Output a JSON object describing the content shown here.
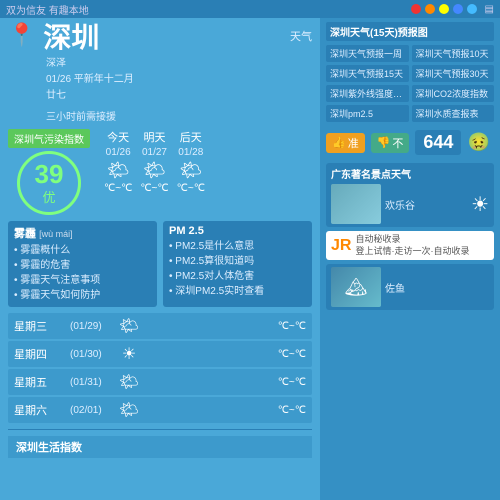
{
  "topbar": {
    "left_text": "双为信友 有趣本地",
    "icons": [
      "red",
      "orange",
      "yellow",
      "blue",
      "teal",
      "gray"
    ]
  },
  "header": {
    "city": "深圳",
    "pin_icon": "📍",
    "weather_label": "天气",
    "date_line1": "深泽",
    "date_line2": "01/26 平新年十二月",
    "date_line3": "廿七",
    "source": "三小时前需接援"
  },
  "aqi": {
    "green_bar": "深圳气污染指数",
    "number": "39",
    "quality": "优"
  },
  "forecast": {
    "today": {
      "label": "今天",
      "date": "01/26",
      "icon": "🌤",
      "temp": "℃~℃"
    },
    "tomorrow": {
      "label": "明天",
      "date": "01/27",
      "icon": "🌤",
      "temp": "℃~℃"
    },
    "aftertomorrow": {
      "label": "后天",
      "date": "01/28",
      "icon": "🌤",
      "temp": "℃~℃"
    }
  },
  "extended": [
    {
      "day": "星期三",
      "date": "(01/29)",
      "icon": "🌤",
      "temp": "℃~℃"
    },
    {
      "day": "星期四",
      "date": "(01/30)",
      "icon": "☀",
      "temp": "℃~℃"
    },
    {
      "day": "星期五",
      "date": "(01/31)",
      "icon": "🌤",
      "temp": "℃~℃"
    },
    {
      "day": "星期六",
      "date": "(02/01)",
      "icon": "🌤",
      "temp": "℃~℃"
    }
  ],
  "fog_box": {
    "title": "雾霾",
    "phonetic": "[wù mái]",
    "items": [
      "• 雾霾概什么",
      "• 雾霾的危害",
      "• 雾霾天气注意事项",
      "• 雾霾天气如何防护"
    ]
  },
  "pm_box": {
    "title": "PM 2.5",
    "items": [
      "• PM2.5是什么意思",
      "• PM2.5算很知道吗",
      "• PM2.5对人体危害",
      "• 深圳PM2.5实时查看"
    ]
  },
  "bottom": {
    "title": "深圳生活指数"
  },
  "right": {
    "header": "深圳天气(15天)预报图",
    "quick_links": [
      "深圳天气预报一周",
      "深圳天气预报10天",
      "深圳天气预报15天",
      "深圳天气预报30天",
      "深圳紫外线强度指数",
      "深圳CO2浓度指数",
      "深圳pm2.5",
      "深圳水质查报表"
    ],
    "vote": {
      "like_label": "准",
      "dislike_label": "不",
      "count": "644",
      "vomit_icon": "🤢"
    },
    "gd_title": "广东著名景点天气",
    "gd_city": "欢乐谷",
    "gd_sun": "☀",
    "more_icon": "🏔",
    "more_text": "佐鱼"
  }
}
